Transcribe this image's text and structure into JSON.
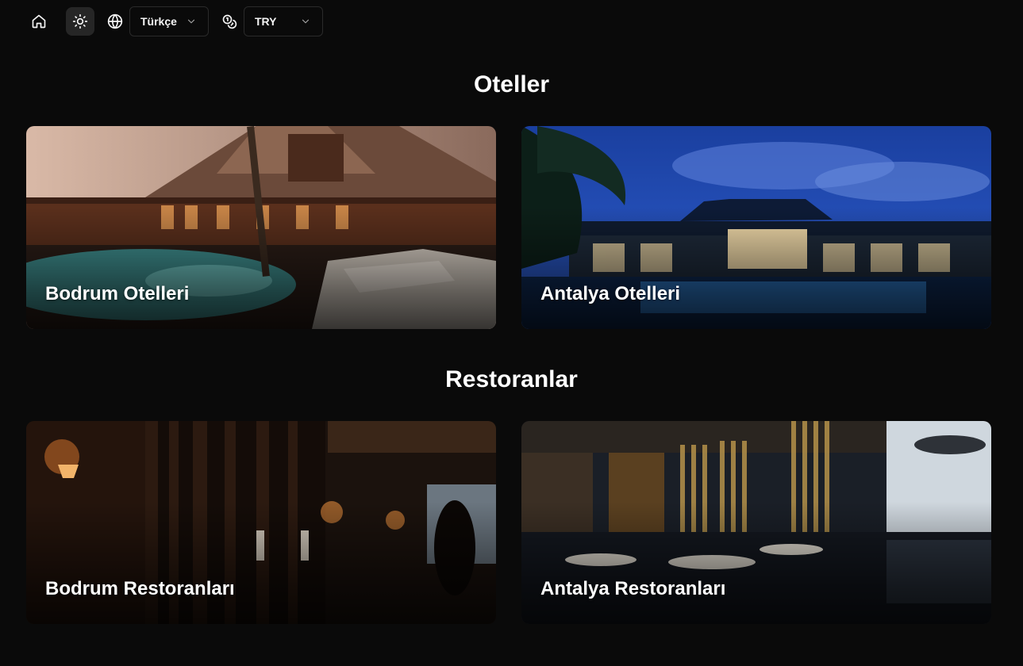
{
  "toolbar": {
    "home_icon": "home-icon",
    "theme_icon": "sun-icon",
    "language_icon": "globe-icon",
    "language_selected": "Türkçe",
    "currency_icon": "coins-icon",
    "currency_selected": "TRY"
  },
  "sections": [
    {
      "title": "Oteller",
      "cards": [
        {
          "label": "Bodrum Otelleri"
        },
        {
          "label": "Antalya Otelleri"
        }
      ]
    },
    {
      "title": "Restoranlar",
      "cards": [
        {
          "label": "Bodrum Restoranları"
        },
        {
          "label": "Antalya Restoranları"
        }
      ]
    }
  ],
  "colors": {
    "background": "#0a0a0a",
    "text": "#ffffff",
    "control_border": "#2a2a2a",
    "active_button": "#262626"
  }
}
